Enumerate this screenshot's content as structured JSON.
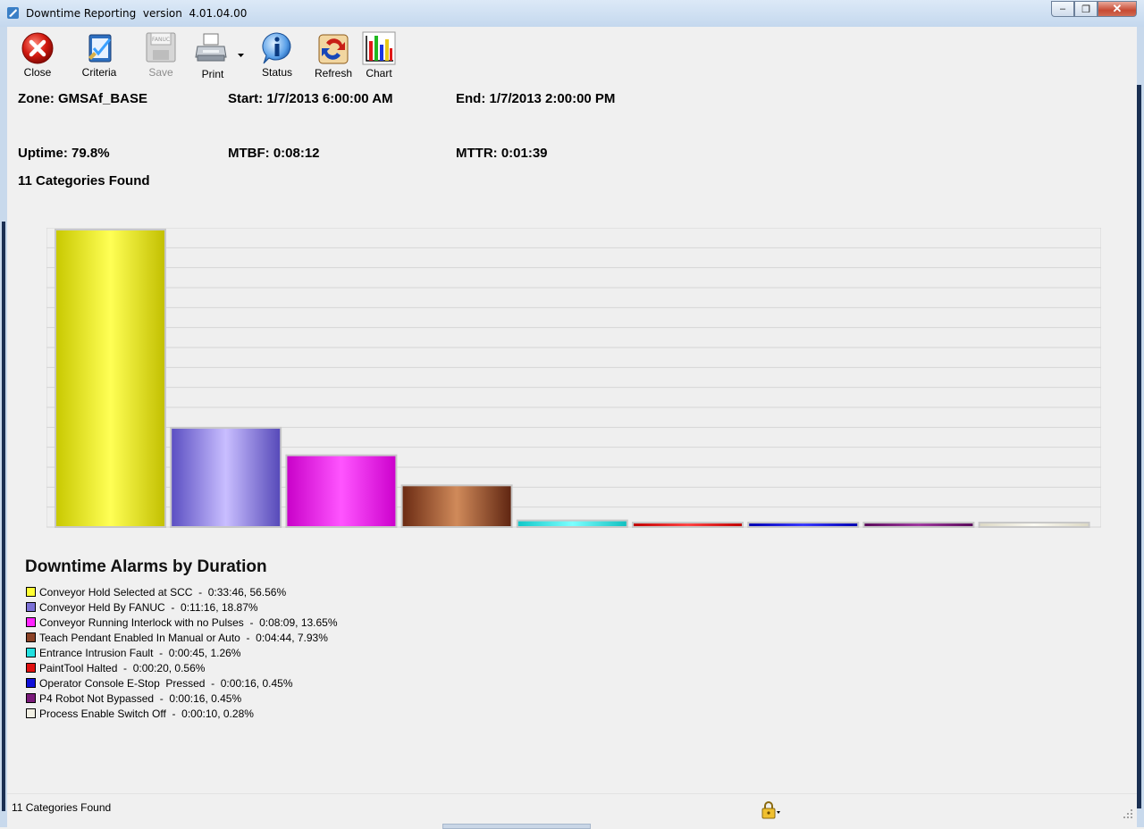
{
  "window": {
    "title": "Downtime Reporting  version  4.01.04.00",
    "minimize_glyph": "–",
    "restore_glyph": "❐",
    "close_glyph": "✕"
  },
  "toolbar": {
    "close_label": "Close",
    "criteria_label": "Criteria",
    "save_label": "Save",
    "save_disk_text": "FANUC",
    "print_label": "Print",
    "status_label": "Status",
    "refresh_label": "Refresh",
    "chart_label": "Chart"
  },
  "summary": {
    "zone": "Zone: GMSAf_BASE",
    "start": "Start: 1/7/2013 6:00:00 AM",
    "end": "End: 1/7/2013 2:00:00 PM",
    "uptime": "Uptime: 79.8%",
    "mtbf": "MTBF: 0:08:12",
    "mttr": "MTTR: 0:01:39",
    "categories_found": "11 Categories Found"
  },
  "chart_data": {
    "type": "bar",
    "title": "Downtime Alarms by Duration",
    "categories": [
      "Conveyor Hold Selected at SCC",
      "Conveyor Held By FANUC",
      "Conveyor Running Interlock with no Pulses",
      "Teach Pendant Enabled In Manual or Auto",
      "Entrance Intrusion Fault",
      "PaintTool Halted",
      "Operator Console E-Stop  Pressed",
      "P4 Robot Not Bypassed",
      "Process Enable Switch Off"
    ],
    "values": [
      56.56,
      18.87,
      13.65,
      7.93,
      1.26,
      0.56,
      0.45,
      0.45,
      0.28
    ],
    "durations": [
      "0:33:46",
      "0:11:16",
      "0:08:09",
      "0:04:44",
      "0:00:45",
      "0:00:20",
      "0:00:16",
      "0:00:16",
      "0:00:10"
    ],
    "colors": [
      "#ffff33",
      "#7b70d6",
      "#ff22ff",
      "#8b4226",
      "#22e0e0",
      "#e01010",
      "#1010d8",
      "#7a1a7a",
      "#f2f0e4"
    ],
    "bar_gradients": [
      [
        "#c8c800",
        "#ffff55",
        "#c2bf00"
      ],
      [
        "#5a4ec2",
        "#c9beff",
        "#5548b8"
      ],
      [
        "#c800c8",
        "#ff55ff",
        "#cc00cc"
      ],
      [
        "#6a2a12",
        "#d08a5a",
        "#5e2410"
      ],
      [
        "#10c8c8",
        "#7cffff",
        "#10c0c0"
      ],
      [
        "#c00000",
        "#ff4444",
        "#c00000"
      ],
      [
        "#0000b0",
        "#3a3aff",
        "#0000b0"
      ],
      [
        "#5a0a5a",
        "#a03aa0",
        "#5a0a5a"
      ],
      [
        "#dcd8c4",
        "#fbfaf2",
        "#dcd8c4"
      ]
    ],
    "legend_entries": [
      "Conveyor Hold Selected at SCC  -  0:33:46, 56.56%",
      "Conveyor Held By FANUC  -  0:11:16, 18.87%",
      "Conveyor Running Interlock with no Pulses  -  0:08:09, 13.65%",
      "Teach Pendant Enabled In Manual or Auto  -  0:04:44, 7.93%",
      "Entrance Intrusion Fault  -  0:00:45, 1.26%",
      "PaintTool Halted  -  0:00:20, 0.56%",
      "Operator Console E-Stop  Pressed  -  0:00:16, 0.45%",
      "P4 Robot Not Bypassed  -  0:00:16, 0.45%",
      "Process Enable Switch Off  -  0:00:10, 0.28%"
    ],
    "ylim": [
      0,
      56.56
    ],
    "grid": true,
    "legend_position": "bottom-left"
  },
  "statusbar": {
    "text": "11 Categories Found"
  }
}
